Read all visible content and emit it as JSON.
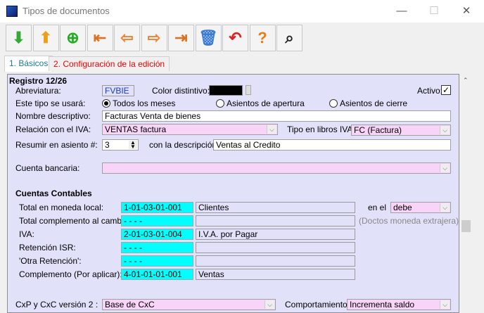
{
  "window": {
    "title": "Tipos de documentos"
  },
  "toolbar": [
    {
      "name": "download-icon",
      "glyph": "⬇",
      "color": "#3a3"
    },
    {
      "name": "upload-icon",
      "glyph": "⬆",
      "color": "#e9a020"
    },
    {
      "name": "new-document-icon",
      "glyph": "⊕",
      "color": "#2a2"
    },
    {
      "name": "first-record-icon",
      "glyph": "⇤",
      "color": "#e07020"
    },
    {
      "name": "previous-record-icon",
      "glyph": "⇦",
      "color": "#f08030"
    },
    {
      "name": "next-record-icon",
      "glyph": "⇨",
      "color": "#f08030"
    },
    {
      "name": "last-record-icon",
      "glyph": "⇥",
      "color": "#e07020"
    },
    {
      "name": "delete-icon",
      "glyph": "🗑",
      "color": "#3a7bd5"
    },
    {
      "name": "undo-icon",
      "glyph": "↶",
      "color": "#d22"
    },
    {
      "name": "help-icon",
      "glyph": "?",
      "color": "#f07810"
    },
    {
      "name": "search-binoculars-icon",
      "glyph": "⌕",
      "color": "#222"
    }
  ],
  "tabs": [
    {
      "label": "1. Básicos"
    },
    {
      "label": "2. Configuración de la edición"
    }
  ],
  "form": {
    "record": "Registro 12/26",
    "abreviatura_label": "Abreviatura:",
    "abreviatura": "FVBIE",
    "color_label": "Color distintivo:",
    "color_value": "#000000",
    "activo_label": "Activo:",
    "activo_check": "✓",
    "uso_label": "Este tipo se usará:",
    "uso_options": [
      "Todos los meses",
      "Asientos de apertura",
      "Asientos de cierre"
    ],
    "nombre_label": "Nombre descriptivo:",
    "nombre": "Facturas Venta de bienes",
    "relacion_label": "Relación con el IVA:",
    "relacion": "VENTAS factura",
    "tipo_libros_label": "Tipo en libros IVA:",
    "tipo_libros": "FC (Factura)",
    "resumir_label": "Resumir en asiento #:",
    "resumir": "3",
    "con_desc_label": "con la descripción",
    "descripcion": "Ventas al Credito",
    "cuenta_bancaria_label": "Cuenta bancaria:",
    "cuenta_bancaria": "",
    "cuentas_title": "Cuentas Contables",
    "cuentas": [
      {
        "label": "Total en moneda local:",
        "code": "1-01-03-01-001",
        "name": "Clientes"
      },
      {
        "label": "Total complemento al cambio:",
        "code": "- - - -",
        "name": ""
      },
      {
        "label": "IVA:",
        "code": "2-01-03-01-004",
        "name": "I.V.A. por Pagar"
      },
      {
        "label": "Retención ISR:",
        "code": "- - - -",
        "name": ""
      },
      {
        "label": "'Otra Retención':",
        "code": "- - - -",
        "name": ""
      },
      {
        "label": "Complemento (Por aplicar):",
        "code": "4-01-01-01-001",
        "name": "Ventas"
      }
    ],
    "en_el_label": "en el",
    "en_el": "debe",
    "doctos_note": "(Doctos moneda extrajera)",
    "cxc_label": "CxP y CxC versión 2 :",
    "cxc": "Base de CxC",
    "comportamiento_label": "Comportamiento:",
    "comportamiento": "Incrementa saldo"
  }
}
